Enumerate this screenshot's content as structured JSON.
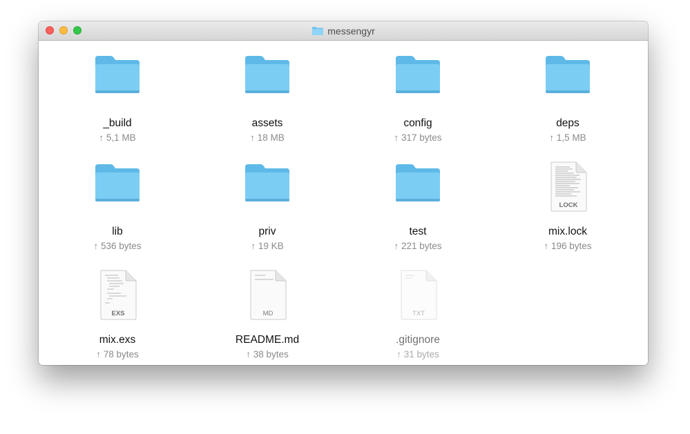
{
  "window": {
    "title": "messengyr",
    "title_icon": "folder-icon"
  },
  "colors": {
    "folder": "#6ec6f1",
    "folder_tab": "#5bb5e6",
    "close": "#fc605c",
    "minimize": "#fdbc40",
    "zoom": "#34c84a"
  },
  "items": [
    {
      "name": "_build",
      "size": "↑ 5,1 MB",
      "kind": "folder"
    },
    {
      "name": "assets",
      "size": "↑ 18 MB",
      "kind": "folder"
    },
    {
      "name": "config",
      "size": "↑ 317 bytes",
      "kind": "folder"
    },
    {
      "name": "deps",
      "size": "↑ 1,5 MB",
      "kind": "folder"
    },
    {
      "name": "lib",
      "size": "↑ 536 bytes",
      "kind": "folder"
    },
    {
      "name": "priv",
      "size": "↑ 19 KB",
      "kind": "folder"
    },
    {
      "name": "test",
      "size": "↑ 221 bytes",
      "kind": "folder"
    },
    {
      "name": "mix.lock",
      "size": "↑ 196 bytes",
      "kind": "document",
      "badge": "LOCK"
    },
    {
      "name": "mix.exs",
      "size": "↑ 78 bytes",
      "kind": "document",
      "badge": "EXS"
    },
    {
      "name": "README.md",
      "size": "↑ 38 bytes",
      "kind": "document",
      "badge": "MD"
    },
    {
      "name": ".gitignore",
      "size": "↑ 31 bytes",
      "kind": "document",
      "badge": "TXT",
      "hidden_file": true
    }
  ]
}
